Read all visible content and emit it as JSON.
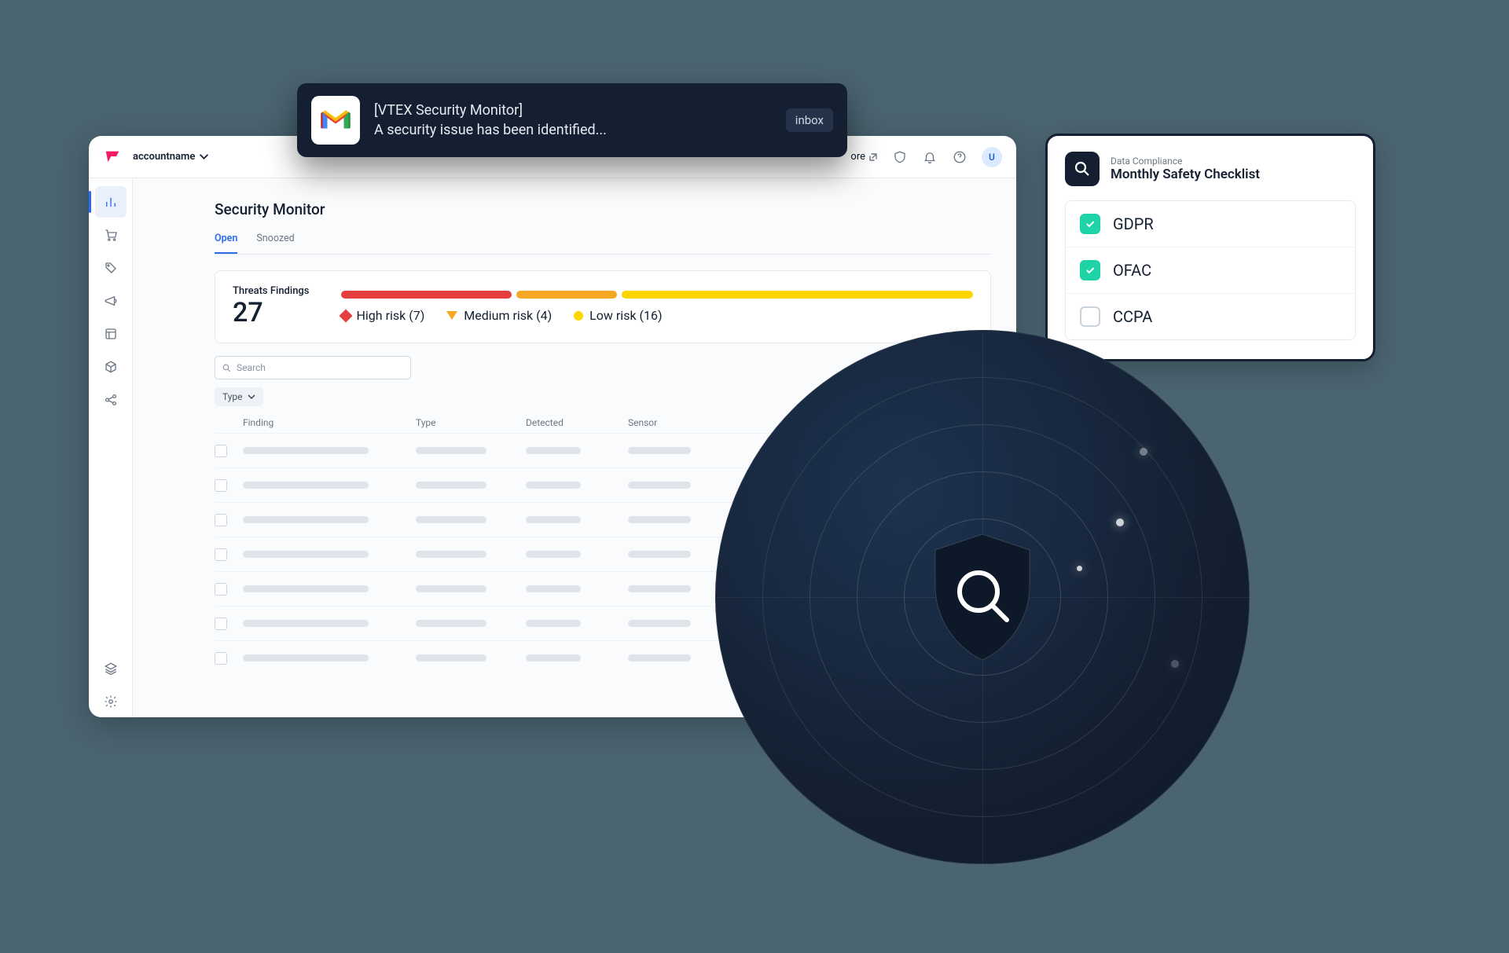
{
  "header": {
    "account": "accountname",
    "more_label": "ore",
    "avatar_initial": "U"
  },
  "page": {
    "title": "Security Monitor",
    "tabs": {
      "open": "Open",
      "snoozed": "Snoozed"
    },
    "summary": {
      "label": "Threats Findings",
      "count": "27",
      "high": "High risk (7)",
      "medium": "Medium risk (4)",
      "low": "Low risk (16)"
    },
    "search_placeholder": "Search",
    "type_filter": "Type",
    "columns": {
      "finding": "Finding",
      "type": "Type",
      "detected": "Detected",
      "sensor": "Sensor"
    }
  },
  "toast": {
    "line1": "[VTEX Security Monitor]",
    "line2": "A security issue has been identified...",
    "badge": "inbox"
  },
  "checklist": {
    "subtitle": "Data Compliance",
    "title": "Monthly Safety Checklist",
    "items": [
      {
        "label": "GDPR",
        "checked": true
      },
      {
        "label": "OFAC",
        "checked": true
      },
      {
        "label": "CCPA",
        "checked": false
      }
    ]
  }
}
